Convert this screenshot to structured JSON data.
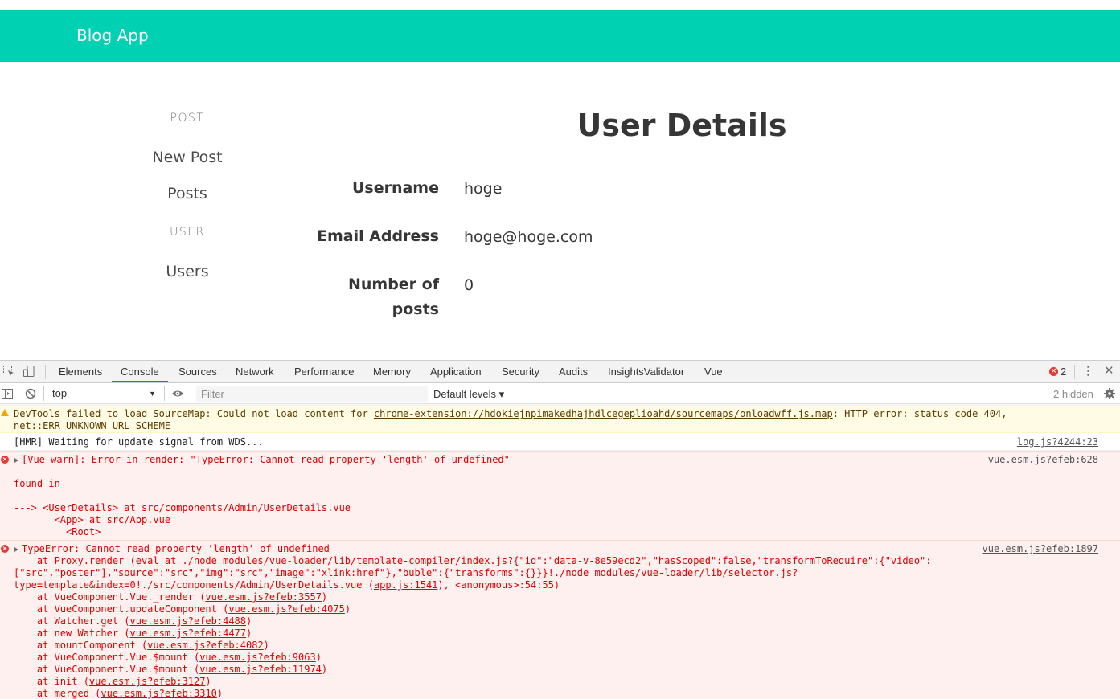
{
  "app": {
    "brand": "Blog App",
    "menu": {
      "post_label": "POST",
      "new_post": "New Post",
      "posts": "Posts",
      "user_label": "USER",
      "users": "Users"
    },
    "title": "User Details",
    "fields": {
      "username_label": "Username",
      "username_value": "hoge",
      "email_label": "Email Address",
      "email_value": "hoge@hoge.com",
      "posts_label_line1": "Number of",
      "posts_label_line2": "posts",
      "posts_value": "0"
    }
  },
  "devtools": {
    "tabs": [
      "Elements",
      "Console",
      "Sources",
      "Network",
      "Performance",
      "Memory",
      "Application",
      "Security",
      "Audits",
      "InsightsValidator",
      "Vue"
    ],
    "active_tab": "Console",
    "error_count": "2",
    "context": "top",
    "filter_placeholder": "Filter",
    "levels": "Default levels ▾",
    "hidden": "2 hidden",
    "messages": {
      "warn_line1_pre": "DevTools failed to load SourceMap: Could not load content for ",
      "warn_line1_link": "chrome-extension://hdokiejnpimakedhajhdlcegeplioahd/sourcemaps/onloadwff.js.map",
      "warn_line1_post": ": HTTP error: status code 404,",
      "warn_line2": "net::ERR_UNKNOWN_URL_SCHEME",
      "log_text": "[HMR] Waiting for update signal from WDS...",
      "log_src": "log.js?4244:23",
      "err1_line1": "[Vue warn]: Error in render: \"TypeError: Cannot read property 'length' of undefined\"",
      "err1_src": "vue.esm.js?efeb:628",
      "err1_line2": "found in",
      "err1_line3": "---> <UserDetails> at src/components/Admin/UserDetails.vue",
      "err1_line4": "       <App> at src/App.vue",
      "err1_line5": "         <Root>",
      "err2_line1": "TypeError: Cannot read property 'length' of undefined",
      "err2_src": "vue.esm.js?efeb:1897",
      "err2_line2": "    at Proxy.render (eval at ./node_modules/vue-loader/lib/template-compiler/index.js?{\"id\":\"data-v-8e59ecd2\",\"hasScoped\":false,\"transformToRequire\":{\"video\":",
      "err2_line3": "[\"src\",\"poster\"],\"source\":\"src\",\"img\":\"src\",\"image\":\"xlink:href\"},\"buble\":{\"transforms\":{}}}!./node_modules/vue-loader/lib/selector.js?",
      "err2_line4_pre": "type=template&index=0!./src/components/Admin/UserDetails.vue (",
      "err2_line4_link": "app.js:1541",
      "err2_line4_post": "), <anonymous>:54:55)",
      "stack": [
        {
          "pre": "    at VueComponent.Vue._render (",
          "link": "vue.esm.js?efeb:3557",
          "post": ")"
        },
        {
          "pre": "    at VueComponent.updateComponent (",
          "link": "vue.esm.js?efeb:4075",
          "post": ")"
        },
        {
          "pre": "    at Watcher.get (",
          "link": "vue.esm.js?efeb:4488",
          "post": ")"
        },
        {
          "pre": "    at new Watcher (",
          "link": "vue.esm.js?efeb:4477",
          "post": ")"
        },
        {
          "pre": "    at mountComponent (",
          "link": "vue.esm.js?efeb:4082",
          "post": ")"
        },
        {
          "pre": "    at VueComponent.Vue.$mount (",
          "link": "vue.esm.js?efeb:9063",
          "post": ")"
        },
        {
          "pre": "    at VueComponent.Vue.$mount (",
          "link": "vue.esm.js?efeb:11974",
          "post": ")"
        },
        {
          "pre": "    at init (",
          "link": "vue.esm.js?efeb:3127",
          "post": ")"
        },
        {
          "pre": "    at merged (",
          "link": "vue.esm.js?efeb:3310",
          "post": ")"
        }
      ]
    }
  }
}
